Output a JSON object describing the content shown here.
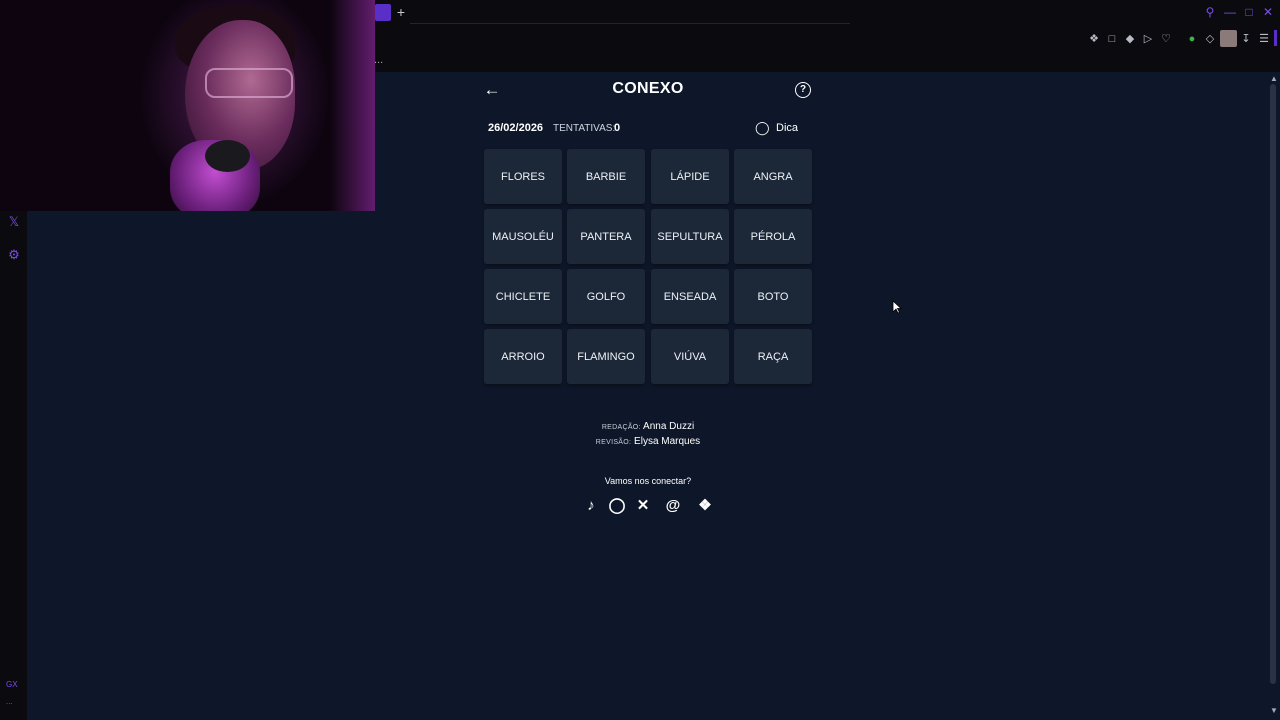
{
  "browser": {
    "new_tab_symbol": "+",
    "address_more": "...",
    "window_controls": [
      "search-icon",
      "minimize-icon",
      "maximize-icon",
      "close-icon"
    ],
    "toolbar_icons": [
      "pin-icon",
      "snapshot-icon",
      "shield-icon",
      "play-icon",
      "heart-icon",
      "vpn-icon",
      "extensions-icon",
      "profile-avatar",
      "download-icon",
      "menu-icon"
    ]
  },
  "sidebar": {
    "icons": [
      "x-twitter-icon",
      "settings-icon"
    ],
    "bottom_label": "GX",
    "bottom_more": "..."
  },
  "game": {
    "title": "CONEXO",
    "date": "26/02/2026",
    "tries_label": "TENTATIVAS:",
    "tries_value": "0",
    "hint_label": "Dica",
    "tiles": [
      [
        "FLORES",
        "BARBIE",
        "LÁPIDE",
        "ANGRA"
      ],
      [
        "MAUSOLÉU",
        "PANTERA",
        "SEPULTURA",
        "PÉROLA"
      ],
      [
        "CHICLETE",
        "GOLFO",
        "ENSEADA",
        "BOTO"
      ],
      [
        "ARROIO",
        "FLAMINGO",
        "VIÚVA",
        "RAÇA"
      ]
    ]
  },
  "credits": {
    "editing_label": "REDAÇÃO:",
    "editing_name": "Anna Duzzi",
    "review_label": "REVISÃO:",
    "review_name": "Elysa Marques"
  },
  "connect": {
    "label": "Vamos nos conectar?",
    "socials": [
      "tiktok-icon",
      "instagram-icon",
      "x-icon",
      "threads-icon",
      "bluesky-icon"
    ]
  },
  "colors": {
    "page_bg": "#0e1729",
    "tile_bg": "#1c2838",
    "accent": "#5a2fc8"
  }
}
